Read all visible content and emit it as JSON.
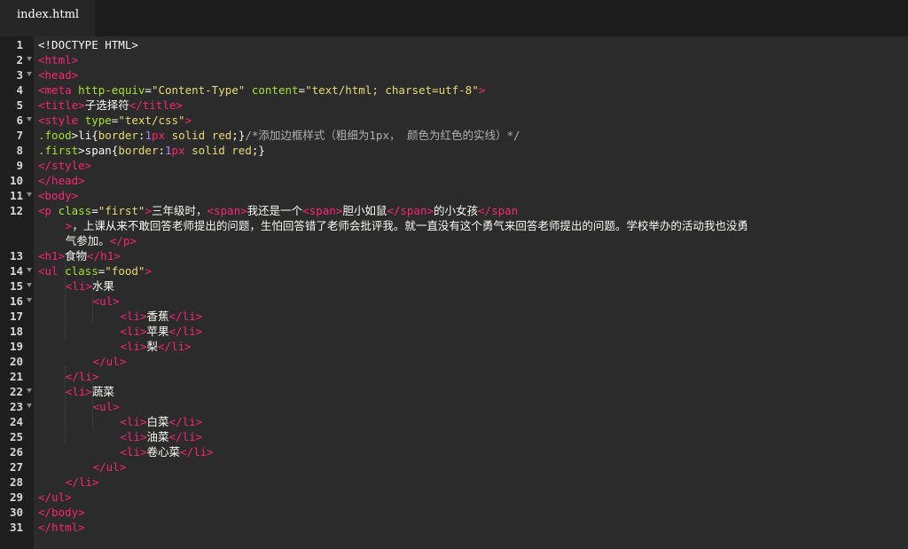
{
  "tab": {
    "title": "index.html"
  },
  "theme": {
    "background": "#2b2b2b",
    "tag": "#f92672",
    "attribute": "#a6e22e",
    "string": "#e6db74",
    "text": "#f8f8f2"
  },
  "lines": [
    {
      "n": "1",
      "tokens": [
        {
          "c": "plain",
          "t": "<!DOCTYPE HTML>"
        }
      ]
    },
    {
      "n": "2",
      "fold": true,
      "tokens": [
        {
          "c": "tag",
          "t": "<html>"
        }
      ]
    },
    {
      "n": "3",
      "fold": true,
      "tokens": [
        {
          "c": "tag",
          "t": "<head>"
        }
      ]
    },
    {
      "n": "4",
      "tokens": [
        {
          "c": "tag",
          "t": "<meta "
        },
        {
          "c": "attr",
          "t": "http-equiv"
        },
        {
          "c": "plain",
          "t": "="
        },
        {
          "c": "str",
          "t": "\"Content-Type\""
        },
        {
          "c": "plain",
          "t": " "
        },
        {
          "c": "attr",
          "t": "content"
        },
        {
          "c": "plain",
          "t": "="
        },
        {
          "c": "str",
          "t": "\"text/html; charset=utf-8\""
        },
        {
          "c": "tag",
          "t": ">"
        }
      ]
    },
    {
      "n": "5",
      "tokens": [
        {
          "c": "tag",
          "t": "<title>"
        },
        {
          "c": "plain",
          "t": "子选择符"
        },
        {
          "c": "tag",
          "t": "</title>"
        }
      ]
    },
    {
      "n": "6",
      "fold": true,
      "tokens": [
        {
          "c": "tag",
          "t": "<style "
        },
        {
          "c": "attr",
          "t": "type"
        },
        {
          "c": "plain",
          "t": "="
        },
        {
          "c": "str",
          "t": "\"text/css\""
        },
        {
          "c": "tag",
          "t": ">"
        }
      ]
    },
    {
      "n": "7",
      "tokens": [
        {
          "c": "sel",
          "t": ".food"
        },
        {
          "c": "plain",
          "t": ">li{"
        },
        {
          "c": "str",
          "t": "border"
        },
        {
          "c": "plain",
          "t": ":"
        },
        {
          "c": "num",
          "t": "1"
        },
        {
          "c": "tag",
          "t": "px"
        },
        {
          "c": "plain",
          "t": " "
        },
        {
          "c": "str",
          "t": "solid red"
        },
        {
          "c": "plain",
          "t": ";}"
        },
        {
          "c": "cm",
          "t": "/*添加边框样式（粗细为1px， 颜色为红色的实线）*/"
        }
      ]
    },
    {
      "n": "8",
      "tokens": [
        {
          "c": "sel",
          "t": ".first"
        },
        {
          "c": "plain",
          "t": ">span{"
        },
        {
          "c": "str",
          "t": "border"
        },
        {
          "c": "plain",
          "t": ":"
        },
        {
          "c": "num",
          "t": "1"
        },
        {
          "c": "tag",
          "t": "px"
        },
        {
          "c": "plain",
          "t": " "
        },
        {
          "c": "str",
          "t": "solid red"
        },
        {
          "c": "plain",
          "t": ";}"
        }
      ]
    },
    {
      "n": "9",
      "tokens": [
        {
          "c": "tag",
          "t": "</style>"
        }
      ]
    },
    {
      "n": "10",
      "tokens": [
        {
          "c": "tag",
          "t": "</head>"
        }
      ]
    },
    {
      "n": "11",
      "fold": true,
      "tokens": [
        {
          "c": "tag",
          "t": "<body>"
        }
      ]
    },
    {
      "n": "12",
      "tokens": [
        {
          "c": "tag",
          "t": "<p "
        },
        {
          "c": "attr",
          "t": "class"
        },
        {
          "c": "plain",
          "t": "="
        },
        {
          "c": "str",
          "t": "\"first\""
        },
        {
          "c": "tag",
          "t": ">"
        },
        {
          "c": "plain",
          "t": "三年级时，"
        },
        {
          "c": "tag",
          "t": "<span>"
        },
        {
          "c": "plain",
          "t": "我还是一个"
        },
        {
          "c": "tag",
          "t": "<span>"
        },
        {
          "c": "plain",
          "t": "胆小如鼠"
        },
        {
          "c": "tag",
          "t": "</span>"
        },
        {
          "c": "plain",
          "t": "的小女孩"
        },
        {
          "c": "tag",
          "t": "</span"
        }
      ]
    },
    {
      "n": "",
      "indent": 4,
      "tokens": [
        {
          "c": "tag",
          "t": ">"
        },
        {
          "c": "plain",
          "t": "，上课从来不敢回答老师提出的问题，生怕回答错了老师会批评我。就一直没有这个勇气来回答老师提出的问题。学校举办的活动我也没勇"
        }
      ]
    },
    {
      "n": "",
      "indent": 4,
      "tokens": [
        {
          "c": "plain",
          "t": "气参加。"
        },
        {
          "c": "tag",
          "t": "</p>"
        }
      ]
    },
    {
      "n": "13",
      "tokens": [
        {
          "c": "tag",
          "t": "<h1>"
        },
        {
          "c": "plain",
          "t": "食物"
        },
        {
          "c": "tag",
          "t": "</h1>"
        }
      ]
    },
    {
      "n": "14",
      "fold": true,
      "tokens": [
        {
          "c": "tag",
          "t": "<ul "
        },
        {
          "c": "attr",
          "t": "class"
        },
        {
          "c": "plain",
          "t": "="
        },
        {
          "c": "str",
          "t": "\"food\""
        },
        {
          "c": "tag",
          "t": ">"
        }
      ]
    },
    {
      "n": "15",
      "fold": true,
      "indent": 4,
      "tokens": [
        {
          "c": "tag",
          "t": "<li>"
        },
        {
          "c": "plain",
          "t": "水果"
        }
      ]
    },
    {
      "n": "16",
      "fold": true,
      "indent": 8,
      "tokens": [
        {
          "c": "tag",
          "t": "<ul>"
        }
      ]
    },
    {
      "n": "17",
      "indent": 12,
      "tokens": [
        {
          "c": "tag",
          "t": "<li>"
        },
        {
          "c": "plain",
          "t": "香蕉"
        },
        {
          "c": "tag",
          "t": "</li>"
        }
      ]
    },
    {
      "n": "18",
      "indent": 12,
      "tokens": [
        {
          "c": "tag",
          "t": "<li>"
        },
        {
          "c": "plain",
          "t": "苹果"
        },
        {
          "c": "tag",
          "t": "</li>"
        }
      ]
    },
    {
      "n": "19",
      "indent": 12,
      "tokens": [
        {
          "c": "tag",
          "t": "<li>"
        },
        {
          "c": "plain",
          "t": "梨"
        },
        {
          "c": "tag",
          "t": "</li>"
        }
      ]
    },
    {
      "n": "20",
      "indent": 8,
      "tokens": [
        {
          "c": "tag",
          "t": "</ul>"
        }
      ]
    },
    {
      "n": "21",
      "indent": 4,
      "tokens": [
        {
          "c": "tag",
          "t": "</li>"
        }
      ]
    },
    {
      "n": "22",
      "fold": true,
      "indent": 4,
      "tokens": [
        {
          "c": "tag",
          "t": "<li>"
        },
        {
          "c": "plain",
          "t": "蔬菜"
        }
      ]
    },
    {
      "n": "23",
      "fold": true,
      "indent": 8,
      "tokens": [
        {
          "c": "tag",
          "t": "<ul>"
        }
      ]
    },
    {
      "n": "24",
      "indent": 12,
      "tokens": [
        {
          "c": "tag",
          "t": "<li>"
        },
        {
          "c": "plain",
          "t": "白菜"
        },
        {
          "c": "tag",
          "t": "</li>"
        }
      ]
    },
    {
      "n": "25",
      "indent": 12,
      "tokens": [
        {
          "c": "tag",
          "t": "<li>"
        },
        {
          "c": "plain",
          "t": "油菜"
        },
        {
          "c": "tag",
          "t": "</li>"
        }
      ]
    },
    {
      "n": "26",
      "indent": 12,
      "tokens": [
        {
          "c": "tag",
          "t": "<li>"
        },
        {
          "c": "plain",
          "t": "卷心菜"
        },
        {
          "c": "tag",
          "t": "</li>"
        }
      ]
    },
    {
      "n": "27",
      "indent": 8,
      "tokens": [
        {
          "c": "tag",
          "t": "</ul>"
        }
      ]
    },
    {
      "n": "28",
      "indent": 4,
      "tokens": [
        {
          "c": "tag",
          "t": "</li>"
        }
      ]
    },
    {
      "n": "29",
      "tokens": [
        {
          "c": "tag",
          "t": "</ul>"
        }
      ]
    },
    {
      "n": "30",
      "tokens": [
        {
          "c": "tag",
          "t": "</body>"
        }
      ]
    },
    {
      "n": "31",
      "tokens": [
        {
          "c": "tag",
          "t": "</html>"
        }
      ]
    }
  ]
}
